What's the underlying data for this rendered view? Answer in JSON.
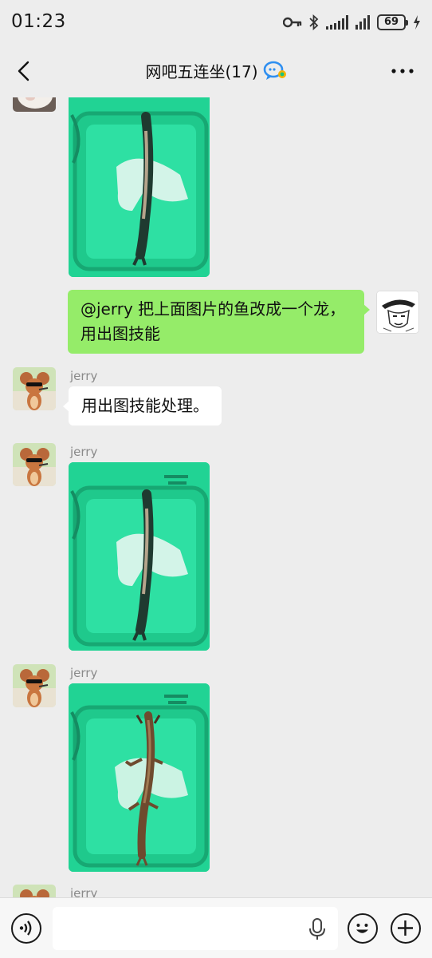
{
  "status_bar": {
    "time": "01:23",
    "battery": "69"
  },
  "header": {
    "title": "网吧五连坐(17)"
  },
  "messages": [
    {
      "type": "image",
      "side": "left",
      "description_icon": "fish-in-tub-image"
    },
    {
      "type": "text",
      "side": "right",
      "text": "@jerry  把上面图片的鱼改成一个龙，用出图技能"
    },
    {
      "type": "text",
      "side": "left",
      "sender": "jerry",
      "text": "用出图技能处理。"
    },
    {
      "type": "image",
      "side": "left",
      "sender": "jerry",
      "description_icon": "fish-in-tub-image"
    },
    {
      "type": "image",
      "side": "left",
      "sender": "jerry",
      "description_icon": "dragon-in-tub-image"
    },
    {
      "type": "partial",
      "side": "left",
      "sender": "jerry"
    }
  ],
  "input": {
    "value": "",
    "placeholder": ""
  },
  "colors": {
    "background": "#ededed",
    "self_bubble": "#95ec69",
    "other_bubble": "#ffffff",
    "image_water": "#22d79a"
  }
}
